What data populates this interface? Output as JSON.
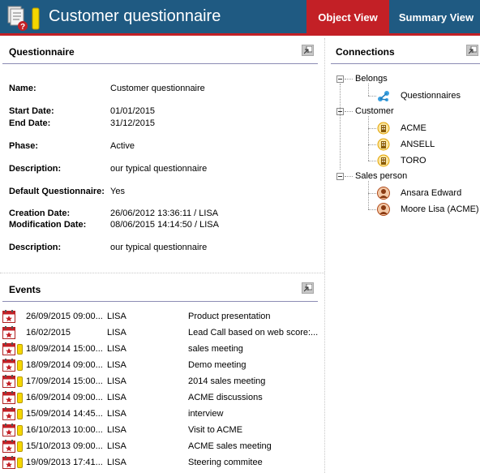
{
  "header": {
    "title": "Customer questionnaire",
    "tabs": [
      {
        "label": "Object View",
        "active": true
      },
      {
        "label": "Summary View",
        "active": false
      }
    ]
  },
  "colors": {
    "header_bg": "#1f5a82",
    "accent": "#c32026"
  },
  "questionnaire": {
    "panel_title": "Questionnaire",
    "fields": {
      "name": {
        "label": "Name:",
        "value": "Customer questionnaire"
      },
      "start_date": {
        "label": "Start Date:",
        "value": "01/01/2015"
      },
      "end_date": {
        "label": "End Date:",
        "value": "31/12/2015"
      },
      "phase": {
        "label": "Phase:",
        "value": "Active"
      },
      "description": {
        "label": "Description:",
        "value": "our typical questionnaire"
      },
      "default_questionnaire": {
        "label": "Default Questionnaire:",
        "value": "Yes"
      },
      "creation_date": {
        "label": "Creation Date:",
        "value": "26/06/2012 13:36:11 / LISA"
      },
      "modification_date": {
        "label": "Modification Date:",
        "value": "08/06/2015 14:14:50 / LISA"
      },
      "description2": {
        "label": "Description:",
        "value": "our typical questionnaire"
      }
    }
  },
  "events": {
    "panel_title": "Events",
    "rows": [
      {
        "date": "26/09/2015 09:00...",
        "user": "LISA",
        "subject": "Product presentation",
        "flag": false
      },
      {
        "date": "16/02/2015",
        "user": "LISA",
        "subject": "Lead Call based on web score:...",
        "flag": false
      },
      {
        "date": "18/09/2014 15:00...",
        "user": "LISA",
        "subject": "sales meeting",
        "flag": true
      },
      {
        "date": "18/09/2014 09:00...",
        "user": "LISA",
        "subject": "Demo meeting",
        "flag": true
      },
      {
        "date": "17/09/2014 15:00...",
        "user": "LISA",
        "subject": "2014 sales meeting",
        "flag": true
      },
      {
        "date": "16/09/2014 09:00...",
        "user": "LISA",
        "subject": "ACME discussions",
        "flag": true
      },
      {
        "date": "15/09/2014 14:45...",
        "user": "LISA",
        "subject": "interview",
        "flag": true
      },
      {
        "date": "16/10/2013 10:00...",
        "user": "LISA",
        "subject": "Visit to ACME",
        "flag": true
      },
      {
        "date": "15/10/2013 09:00...",
        "user": "LISA",
        "subject": "ACME sales meeting",
        "flag": true
      },
      {
        "date": "19/09/2013 17:41...",
        "user": "LISA",
        "subject": "Steering commitee",
        "flag": true
      }
    ]
  },
  "connections": {
    "panel_title": "Connections",
    "groups": [
      {
        "label": "Belongs",
        "icon": "questionnaire-icon",
        "children": [
          "Questionnaires"
        ]
      },
      {
        "label": "Customer",
        "icon": "company-icon",
        "children": [
          "ACME",
          "ANSELL",
          "TORO"
        ]
      },
      {
        "label": "Sales person",
        "icon": "person-icon",
        "children": [
          "Ansara Edward",
          "Moore Lisa (ACME)"
        ]
      }
    ]
  }
}
